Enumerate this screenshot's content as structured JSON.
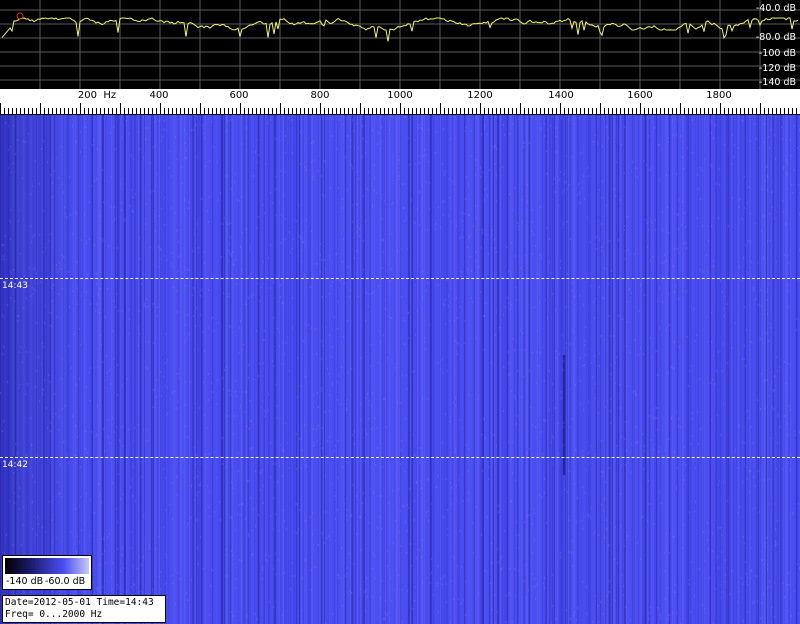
{
  "spectrum": {
    "db_labels": [
      "-40.0 dB",
      "-80.0 dB",
      "-100 dB",
      "-120 dB",
      "-140 dB"
    ],
    "trace_color": "#f4f46a",
    "grid_color": "#5a5a5a"
  },
  "freq_axis": {
    "labels": [
      {
        "hz": 200,
        "text": "200  Hz"
      },
      {
        "hz": 400,
        "text": "400"
      },
      {
        "hz": 600,
        "text": "600"
      },
      {
        "hz": 800,
        "text": "800"
      },
      {
        "hz": 1000,
        "text": "1000"
      },
      {
        "hz": 1200,
        "text": "1200"
      },
      {
        "hz": 1400,
        "text": "1400"
      },
      {
        "hz": 1600,
        "text": "1600"
      },
      {
        "hz": 1800,
        "text": "1800"
      }
    ],
    "min_hz": 0,
    "max_hz": 1950
  },
  "waterfall": {
    "base_color": "#4a4ef0",
    "time_marks": [
      "14:43",
      "14:42"
    ]
  },
  "legend": {
    "low": "-140 dB",
    "high": "-60.0 dB"
  },
  "info": {
    "line1": "Date=2012-05-01 Time=14:43",
    "line2": "Freq= 0...2000 Hz"
  }
}
